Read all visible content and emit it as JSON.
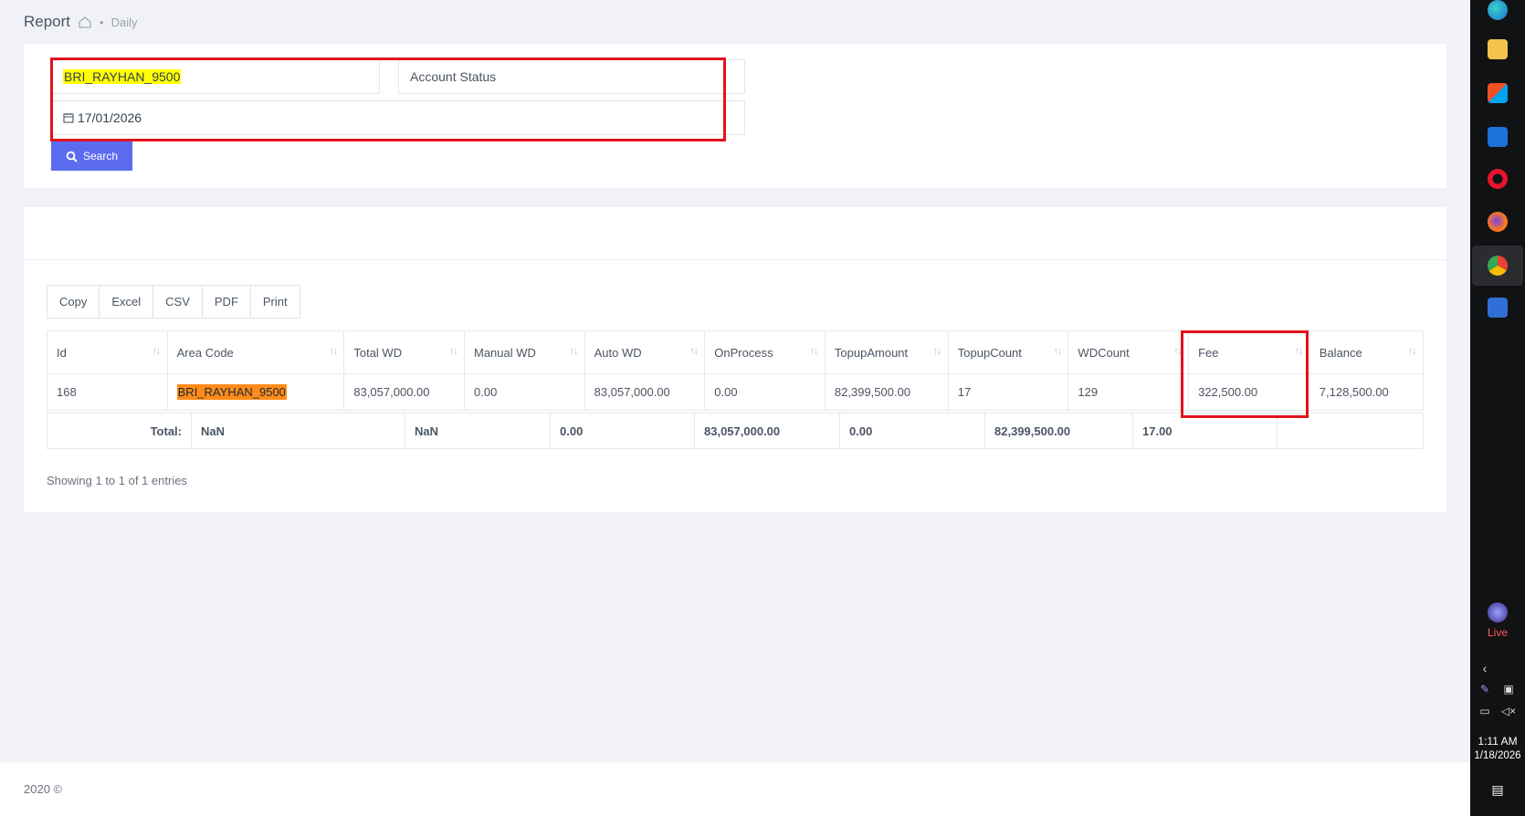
{
  "page": {
    "title": "Report",
    "breadcrumb": "Daily",
    "breadcrumb_sep": "•"
  },
  "filters": {
    "area_code_value": "BRI_RAYHAN_9500",
    "account_status_placeholder": "Account Status",
    "date_value": "17/01/2026",
    "search_label": "Search"
  },
  "export_buttons": [
    "Copy",
    "Excel",
    "CSV",
    "PDF",
    "Print"
  ],
  "table": {
    "columns": [
      "Id",
      "Area Code",
      "Total WD",
      "Manual WD",
      "Auto WD",
      "OnProcess",
      "TopupAmount",
      "TopupCount",
      "WDCount",
      "Fee",
      "Balance"
    ],
    "rows": [
      [
        "168",
        "BRI_RAYHAN_9500",
        "83,057,000.00",
        "0.00",
        "83,057,000.00",
        "0.00",
        "82,399,500.00",
        "17",
        "129",
        "322,500.00",
        "7,128,500.00"
      ]
    ],
    "totals": [
      "Total:",
      "NaN",
      "NaN",
      "0.00",
      "83,057,000.00",
      "0.00",
      "82,399,500.00",
      "17.00",
      ""
    ],
    "info": "Showing 1 to 1 of 1 entries"
  },
  "footer": {
    "text": "2020 ©"
  },
  "taskbar": {
    "live_label": "Live",
    "time": "1:11 AM",
    "date": "1/18/2026",
    "icons": [
      "edge-icon",
      "file-explorer-icon",
      "store-icon",
      "outlook-icon",
      "opera-icon",
      "firefox-icon",
      "chrome-icon",
      "calculator-icon"
    ]
  },
  "colors": {
    "accent": "#5b6cf0",
    "highlight_yellow": "#ffff00",
    "highlight_orange": "#ff8c1a",
    "annotation_red": "#e3121b"
  }
}
